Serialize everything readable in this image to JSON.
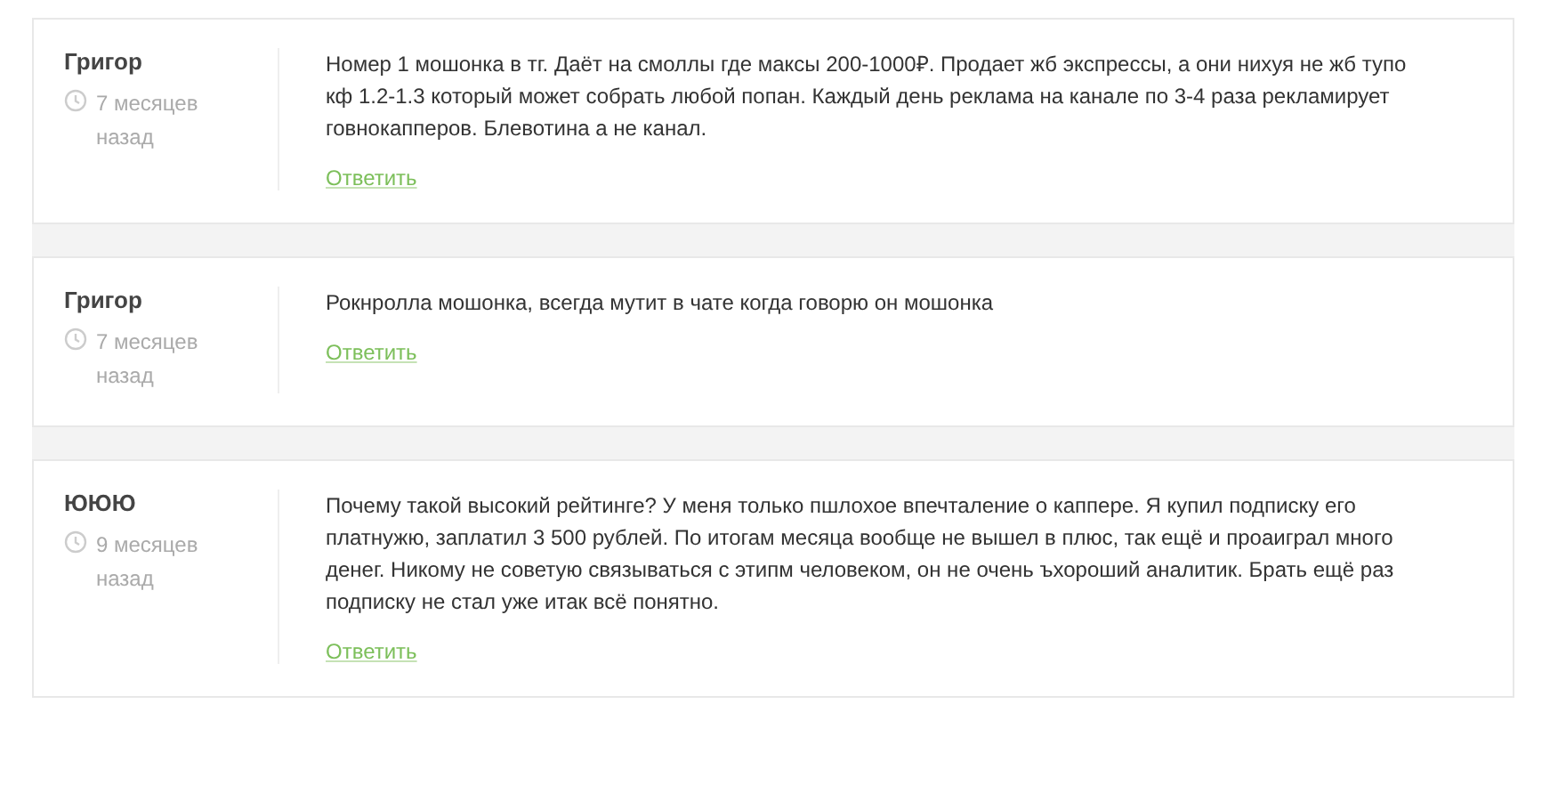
{
  "comments": [
    {
      "author": "Григор",
      "time": "7 месяцев назад",
      "text": "Номер 1 мошонка в тг. Даёт на смоллы где максы 200-1000₽. Продает жб экспрессы, а они нихуя не жб тупо кф 1.2-1.3 который может собрать любой попан. Каждый день реклама на канале по 3-4 раза рекламирует говнокапперов. Блевотина а не канал.",
      "reply": "Ответить"
    },
    {
      "author": "Григор",
      "time": "7 месяцев назад",
      "text": "Рокнролла мошонка, всегда мутит в чате когда говорю он мошонка",
      "reply": "Ответить"
    },
    {
      "author": "ЮЮЮ",
      "time": "9 месяцев назад",
      "text": "Почему такой высокий рейтинге? У меня только пшлохое впечталение о каппере. Я купил подписку его платнужю, заплатил 3 500 рублей. По итогам месяца вообще не вышел в плюс, так ещё и проаиграл много денег. Никому не советую связываться с этипм человеком, он не очень ъхороший аналитик. Брать ещё раз подписку не стал уже итак всё понятно.",
      "reply": "Ответить"
    }
  ]
}
